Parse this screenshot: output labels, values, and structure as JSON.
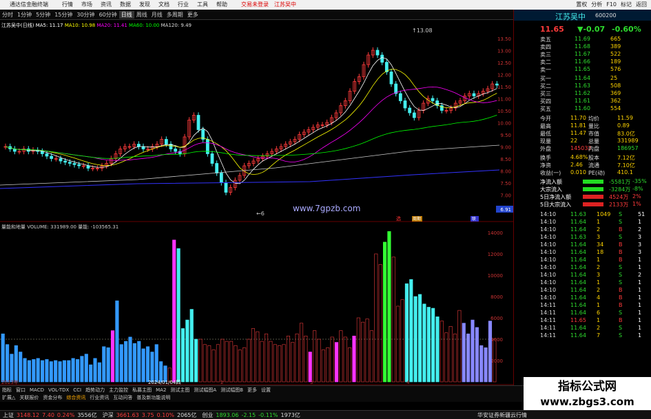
{
  "titlebar": {
    "app": "通达信金融终端",
    "menus": [
      "行情",
      "市场",
      "资讯",
      "数据",
      "发现",
      "文档",
      "行业",
      "工具",
      "帮助"
    ],
    "red1": "交易未登录",
    "red2": "江苏吴中",
    "right": [
      "置权",
      "分析",
      "F10",
      "标记",
      "返回"
    ]
  },
  "toolbar": [
    "分时",
    "1分钟",
    "5分钟",
    "15分钟",
    "30分钟",
    "60分钟",
    "日线",
    "周线",
    "月线",
    "多周期",
    "更多"
  ],
  "chart": {
    "header": "江苏吴中(日线)",
    "ma5": "MA5: 11.17",
    "ma10": "MA10: 10.98",
    "ma20": "MA20: 11.41",
    "ma60": "MA60: 10.00",
    "ma120": "MA120: 9.49",
    "hi": "13.08",
    "lo": "6",
    "site": "www.7gpzb.com",
    "markers": [
      "选",
      "周期",
      "联"
    ],
    "last": "6.91",
    "yticks": [
      "13.50",
      "13.00",
      "12.50",
      "12.00",
      "11.50",
      "11.00",
      "10.50",
      "10.00",
      "9.50",
      "9.00",
      "8.50",
      "8.00",
      "7.50",
      "7.00",
      "6.50"
    ],
    "xticks": [
      "2023年",
      "2024/01/04四",
      "2",
      "3",
      "4"
    ]
  },
  "volume": {
    "header": "量能和地量 VOLUME: 331989.00 量能: -103565.31",
    "yticks": [
      "14000",
      "12000",
      "10000",
      "8000",
      "6000",
      "4000",
      "2000"
    ],
    "bars": [
      4.5,
      3.5,
      2.6,
      3.4,
      2.8,
      2.2,
      2,
      2.1,
      2.2,
      2,
      2.1,
      1.9,
      2,
      1.9,
      2,
      2,
      2.2,
      2.1,
      2.4,
      2.6,
      1.6,
      2.2,
      1.8,
      3.3,
      3.2,
      4.8,
      7.6,
      3.5,
      3.8,
      4.2,
      3.6,
      3.8,
      3.1,
      3.3,
      2.8,
      3.5,
      1.9,
      1.5,
      1.3,
      13.3,
      12.5,
      5,
      5.8,
      6.8,
      4,
      4,
      3.5,
      3.4,
      3,
      3.5,
      4,
      3.8,
      3.8,
      3.4,
      3,
      3.2,
      4,
      5,
      4.7,
      3.8,
      4.5,
      3.8,
      3.5,
      3.4,
      3.5,
      4.3,
      3.7,
      4.5,
      5.5,
      4.3,
      2.8,
      4.8,
      4,
      3,
      3.2,
      4.2,
      3.7,
      4.8,
      4.2,
      3.2,
      4.3,
      6,
      5.6,
      5.9,
      4.8,
      12,
      11,
      13.1,
      14.1,
      11.7,
      7.1,
      7.7,
      9.2,
      9.6,
      8,
      8.2,
      7.3,
      7,
      6.9,
      6.1,
      5.7,
      4.6,
      5.2,
      4.5,
      6.7,
      5.5,
      4.5,
      5.8,
      5.1,
      3.4,
      3.2,
      5.7,
      4
    ]
  },
  "quote": {
    "name": "江苏吴中",
    "code": "600200",
    "price": "11.65",
    "chg": "▼-0.07",
    "pct": "-0.60%",
    "asks": [
      [
        "卖五",
        "11.69",
        "665"
      ],
      [
        "卖四",
        "11.68",
        "389"
      ],
      [
        "卖三",
        "11.67",
        "522"
      ],
      [
        "卖二",
        "11.66",
        "189"
      ],
      [
        "卖一",
        "11.65",
        "576"
      ]
    ],
    "bids": [
      [
        "买一",
        "11.64",
        "25"
      ],
      [
        "买二",
        "11.63",
        "508"
      ],
      [
        "买三",
        "11.62",
        "369"
      ],
      [
        "买四",
        "11.61",
        "362"
      ],
      [
        "买五",
        "11.60",
        "554"
      ]
    ],
    "stats": [
      [
        "今开",
        "11.70",
        "均价",
        "11.59"
      ],
      [
        "最高",
        "11.81",
        "量比",
        "0.89"
      ],
      [
        "最低",
        "11.47",
        "市值",
        "83.0亿"
      ],
      [
        "现量",
        "22",
        "总量",
        "331989"
      ],
      [
        "外盘",
        "145032",
        "内盘",
        "186957"
      ],
      [
        "换手",
        "4.68%",
        "股本",
        "7.12亿"
      ],
      [
        "净资",
        "2.46",
        "流通",
        "7.10亿"
      ],
      [
        "收益(一)",
        "0.010",
        "PE(动)",
        "410.1"
      ]
    ],
    "flows": [
      [
        "净流入额",
        "-5581万",
        "-35%"
      ],
      [
        "大宗流入",
        "-3284万",
        "-8%"
      ],
      [
        "5日净流入额",
        "4524万",
        "2%"
      ],
      [
        "5日大宗流入",
        "2133万",
        "1%"
      ]
    ],
    "ticks": [
      [
        "14:10",
        "11.63",
        "1049",
        "S",
        "51"
      ],
      [
        "14:10",
        "11.64",
        "1",
        "S",
        "1"
      ],
      [
        "14:10",
        "11.64",
        "2",
        "B",
        "2"
      ],
      [
        "14:10",
        "11.63",
        "3",
        "S",
        "3"
      ],
      [
        "14:10",
        "11.64",
        "34",
        "B",
        "3"
      ],
      [
        "14:10",
        "11.64",
        "18",
        "B",
        "3"
      ],
      [
        "14:10",
        "11.64",
        "1",
        "B",
        "1"
      ],
      [
        "14:10",
        "11.64",
        "2",
        "S",
        "1"
      ],
      [
        "14:10",
        "11.64",
        "3",
        "S",
        "2"
      ],
      [
        "14:10",
        "11.64",
        "1",
        "S",
        "1"
      ],
      [
        "14:10",
        "11.64",
        "2",
        "B",
        "1"
      ],
      [
        "14:10",
        "11.64",
        "4",
        "B",
        "1"
      ],
      [
        "14:11",
        "11.64",
        "1",
        "B",
        "1"
      ],
      [
        "14:11",
        "11.64",
        "6",
        "S",
        "1"
      ],
      [
        "14:11",
        "11.65",
        "1",
        "B",
        "1"
      ],
      [
        "14:11",
        "11.64",
        "2",
        "S",
        "1"
      ],
      [
        "14:11",
        "11.64",
        "7",
        "S",
        "1"
      ]
    ]
  },
  "bottom1": [
    "指标",
    "窗口",
    "MACD",
    "VOL-TDX",
    "CCI",
    "趋势动力",
    "主力监控",
    "私募主图",
    "MA2",
    "测试主图",
    "测试幅图A",
    "测试幅图B",
    "更多",
    "设置"
  ],
  "bottom2": [
    "扩展△",
    "关联报价",
    "资金分布",
    "综合资讯",
    "行业资讯",
    "互动问答",
    "普及新功能说明"
  ],
  "status": [
    [
      "上证",
      "3148.12",
      "7.40",
      "0.24%",
      "3556亿"
    ],
    [
      "沪深",
      "3661.63",
      "3.75",
      "0.10%",
      "2065亿"
    ],
    [
      "创业",
      "1893.06",
      "-2.15",
      "-0.11%",
      "1973亿"
    ]
  ],
  "status_right": "华安证券新疆云行情",
  "watermark": {
    "line1": "指标公式网",
    "line2": "www.zbgs3.com"
  }
}
